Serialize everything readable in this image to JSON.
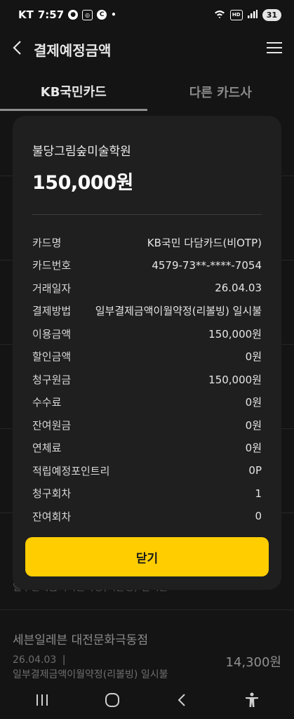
{
  "status_bar": {
    "carrier": "KT",
    "time": "7:57",
    "talk_label": "TALK",
    "battery": "31"
  },
  "header": {
    "title": "결제예정금액"
  },
  "tabs": [
    {
      "label": "KB국민카드",
      "active": true
    },
    {
      "label": "다른 카드사",
      "active": false
    }
  ],
  "background_list": {
    "partial_item_text": "일부결제금액이월약정(리볼빙) 일시불",
    "item": {
      "merchant": "세븐일레븐 대전문화극동점",
      "date": "26.04.03",
      "separator": "|",
      "payment_method": "일부결제금액이월약정(리볼빙) 일시불",
      "amount": "14,300원"
    }
  },
  "modal": {
    "merchant": "불당그림숲미술학원",
    "amount": "150,000원",
    "rows": [
      {
        "label": "카드명",
        "value": "KB국민 다담카드(비OTP)"
      },
      {
        "label": "카드번호",
        "value": "4579-73**-****-7054"
      },
      {
        "label": "거래일자",
        "value": "26.04.03"
      },
      {
        "label": "결제방법",
        "value": "일부결제금액이월약정(리볼빙) 일시불"
      },
      {
        "label": "이용금액",
        "value": "150,000원"
      },
      {
        "label": "할인금액",
        "value": "0원"
      },
      {
        "label": "청구원금",
        "value": "150,000원"
      },
      {
        "label": "수수료",
        "value": "0원"
      },
      {
        "label": "잔여원금",
        "value": "0원"
      },
      {
        "label": "연체료",
        "value": "0원"
      },
      {
        "label": "적립예정포인트리",
        "value": "0P"
      },
      {
        "label": "청구회차",
        "value": "1"
      },
      {
        "label": "잔여회차",
        "value": "0"
      }
    ],
    "close_label": "닫기"
  },
  "colors": {
    "background": "#141414",
    "modal": "#1f1f1f",
    "accent": "#ffcd00"
  }
}
